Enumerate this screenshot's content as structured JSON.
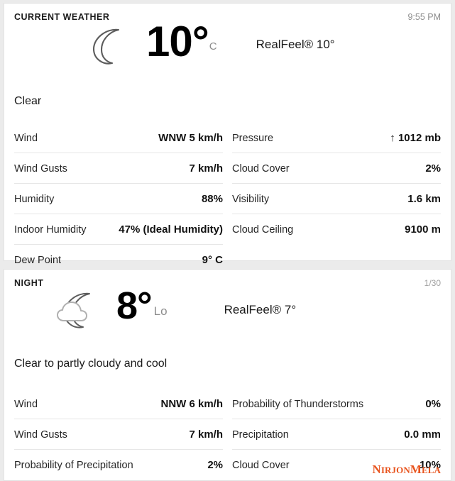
{
  "theme": {
    "page_bg": "#ebebeb",
    "card_bg": "#ffffff",
    "text": "#1a1a1a",
    "muted": "#8d8d8d",
    "divider": "#e6e6e6",
    "watermark": "#e8541e"
  },
  "current": {
    "label": "CURRENT WEATHER",
    "time": "9:55 PM",
    "icon": "crescent-moon-icon",
    "temperature": "10",
    "degree": "°",
    "unit": "C",
    "realfeel": "RealFeel® 10°",
    "phrase": "Clear",
    "left_rows": [
      {
        "label": "Wind",
        "value": "WNW 5 km/h"
      },
      {
        "label": "Wind Gusts",
        "value": "7 km/h"
      },
      {
        "label": "Humidity",
        "value": "88%"
      },
      {
        "label": "Indoor Humidity",
        "value": "47% (Ideal Humidity)"
      },
      {
        "label": "Dew Point",
        "value": "9° C"
      }
    ],
    "right_rows": [
      {
        "label": "Pressure",
        "value": "↑ 1012 mb"
      },
      {
        "label": "Cloud Cover",
        "value": "2%"
      },
      {
        "label": "Visibility",
        "value": "1.6 km"
      },
      {
        "label": "Cloud Ceiling",
        "value": "9100 m"
      }
    ]
  },
  "night": {
    "label": "NIGHT",
    "date": "1/30",
    "icon": "moon-with-cloud-icon",
    "temperature": "8",
    "degree": "°",
    "unit": "Lo",
    "realfeel": "RealFeel® 7°",
    "phrase": "Clear to partly cloudy and cool",
    "left_rows": [
      {
        "label": "Wind",
        "value": "NNW 6 km/h"
      },
      {
        "label": "Wind Gusts",
        "value": "7 km/h"
      },
      {
        "label": "Probability of Precipitation",
        "value": "2%"
      }
    ],
    "right_rows": [
      {
        "label": "Probability of Thunderstorms",
        "value": "0%"
      },
      {
        "label": "Precipitation",
        "value": "0.0 mm"
      },
      {
        "label": "Cloud Cover",
        "value": "10%"
      }
    ]
  },
  "watermark": {
    "part1_big": "N",
    "part1_small": "IRJON",
    "part2_big": "M",
    "part2_small": "ELA"
  }
}
